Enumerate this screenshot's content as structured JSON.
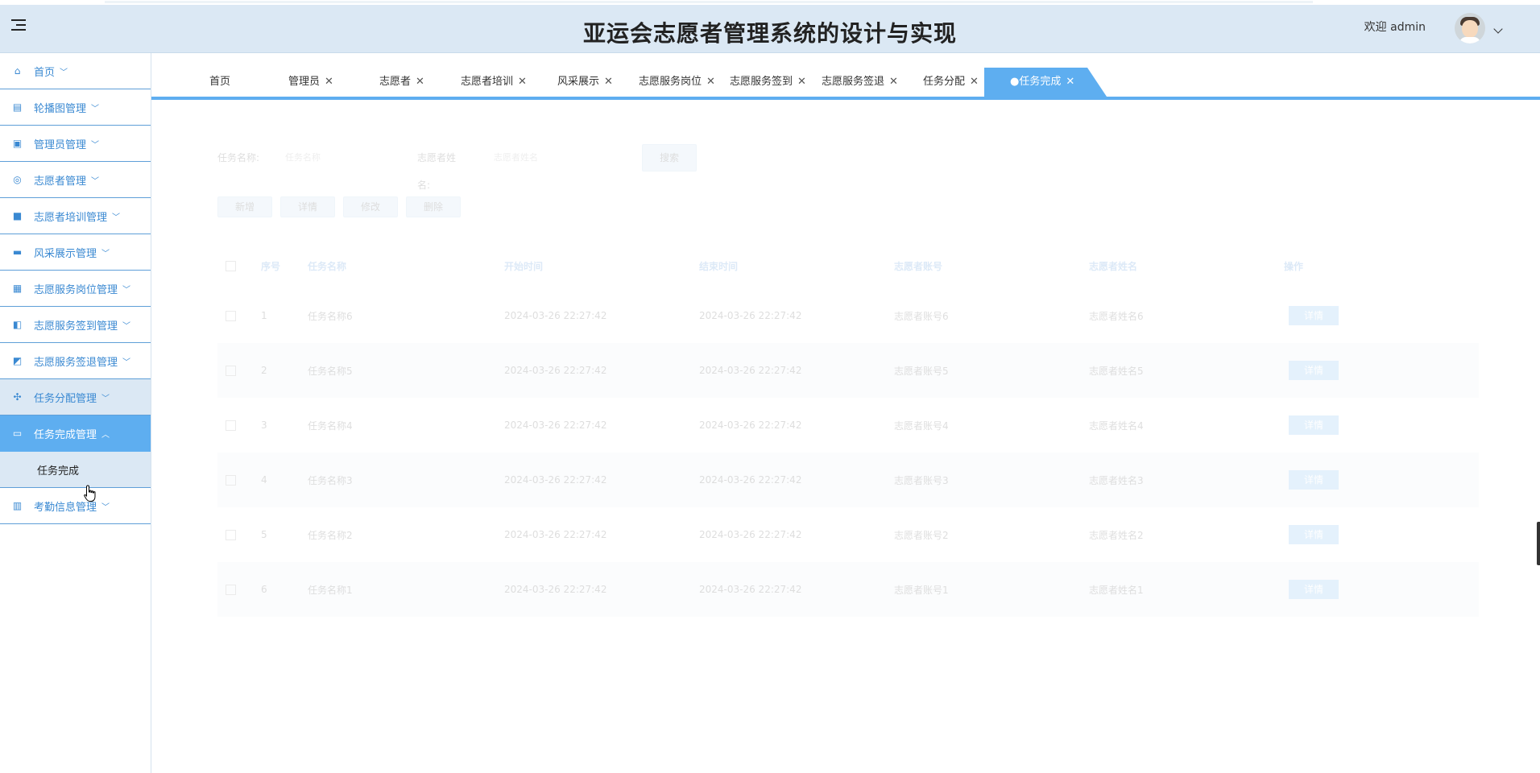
{
  "header": {
    "title": "亚运会志愿者管理系统的设计与实现",
    "welcome": "欢迎 admin"
  },
  "sidebar": {
    "items": [
      {
        "label": "首页",
        "icon": "home-icon"
      },
      {
        "label": "轮播图管理",
        "icon": "carousel-icon"
      },
      {
        "label": "管理员管理",
        "icon": "chip-icon"
      },
      {
        "label": "志愿者管理",
        "icon": "badge-icon"
      },
      {
        "label": "志愿者培训管理",
        "icon": "book-icon"
      },
      {
        "label": "风采展示管理",
        "icon": "laptop-icon"
      },
      {
        "label": "志愿服务岗位管理",
        "icon": "grid-icon"
      },
      {
        "label": "志愿服务签到管理",
        "icon": "panel-icon"
      },
      {
        "label": "志愿服务签退管理",
        "icon": "signout-icon"
      },
      {
        "label": "任务分配管理",
        "icon": "apps-icon"
      },
      {
        "label": "任务完成管理",
        "icon": "task-icon"
      },
      {
        "label": "考勤信息管理",
        "icon": "columns-icon"
      }
    ],
    "submenu_label": "任务完成"
  },
  "tabs": [
    {
      "label": "首页"
    },
    {
      "label": "管理员"
    },
    {
      "label": "志愿者"
    },
    {
      "label": "志愿者培训"
    },
    {
      "label": "风采展示"
    },
    {
      "label": "志愿服务岗位"
    },
    {
      "label": "志愿服务签到"
    },
    {
      "label": "志愿服务签退"
    },
    {
      "label": "任务分配"
    },
    {
      "label": "●任务完成"
    }
  ],
  "search": {
    "task_name_label": "任务名称:",
    "task_name_placeholder": "任务名称",
    "volunteer_name_label_1": "志愿者姓",
    "volunteer_name_label_2": "名:",
    "volunteer_name_placeholder": "志愿者姓名",
    "search_button": "搜索"
  },
  "actions": {
    "add": "新增",
    "detail": "详情",
    "edit": "修改",
    "delete": "删除"
  },
  "table": {
    "headers": {
      "index": "序号",
      "task_name": "任务名称",
      "start_time": "开始时间",
      "end_time": "结束时间",
      "account": "志愿者账号",
      "name": "志愿者姓名",
      "ops": "操作"
    },
    "rows": [
      {
        "index": "1",
        "task_name": "任务名称6",
        "start_time": "2024-03-26 22:27:42",
        "end_time": "2024-03-26 22:27:42",
        "account": "志愿者账号6",
        "name": "志愿者姓名6",
        "btn": "详情"
      },
      {
        "index": "2",
        "task_name": "任务名称5",
        "start_time": "2024-03-26 22:27:42",
        "end_time": "2024-03-26 22:27:42",
        "account": "志愿者账号5",
        "name": "志愿者姓名5",
        "btn": "详情"
      },
      {
        "index": "3",
        "task_name": "任务名称4",
        "start_time": "2024-03-26 22:27:42",
        "end_time": "2024-03-26 22:27:42",
        "account": "志愿者账号4",
        "name": "志愿者姓名4",
        "btn": "详情"
      },
      {
        "index": "4",
        "task_name": "任务名称3",
        "start_time": "2024-03-26 22:27:42",
        "end_time": "2024-03-26 22:27:42",
        "account": "志愿者账号3",
        "name": "志愿者姓名3",
        "btn": "详情"
      },
      {
        "index": "5",
        "task_name": "任务名称2",
        "start_time": "2024-03-26 22:27:42",
        "end_time": "2024-03-26 22:27:42",
        "account": "志愿者账号2",
        "name": "志愿者姓名2",
        "btn": "详情"
      },
      {
        "index": "6",
        "task_name": "任务名称1",
        "start_time": "2024-03-26 22:27:42",
        "end_time": "2024-03-26 22:27:42",
        "account": "志愿者账号1",
        "name": "志愿者姓名1",
        "btn": "详情"
      }
    ]
  },
  "colors": {
    "accent": "#5eaef0",
    "menu_text": "#3a89d2",
    "header_bg": "#dbe8f4"
  }
}
